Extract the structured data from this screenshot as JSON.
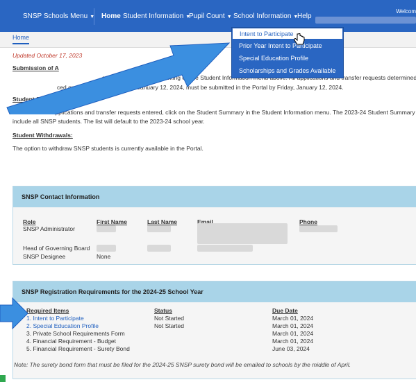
{
  "nav": {
    "menu_label": "SNSP Schools Menu",
    "home": "Home",
    "student_info": "Student Information",
    "pupil_count": "Pupil Count",
    "school_info": "School Information",
    "help": "Help",
    "welcome": "Welcom"
  },
  "tab": {
    "home": "Home"
  },
  "dropdown": {
    "items": [
      "Intent to Participate",
      "Prior Year Intent to Participate",
      "Special Education Profile",
      "Scholarships and Grades Available"
    ],
    "active_index": 0
  },
  "content": {
    "updated": "Updated October 17, 2023",
    "submission_heading": "Submission of A",
    "submission_heading_tail": "...:",
    "submission_line1": "s can be submitted by clicking on the Student Information menu above. All applications and transfer requests determined",
    "submission_line2": "ced on a waiting list by Friday, January 12, 2024, must be submitted in the Portal by Friday, January 12, 2024.",
    "summary_heading": "Student Summary:",
    "summary_line1": "To see a list of applications and transfer requests entered, click on the Student Summary in the Student Information menu. The 2023-24 Student Summary wi",
    "summary_line2": "include all SNSP students. The list will default to the 2023-24 school year.",
    "withdrawals_heading": "Student Withdrawals:",
    "withdrawals_line": "The option to withdraw SNSP students is currently available in the Portal."
  },
  "contact": {
    "title": "SNSP Contact Information",
    "headers": {
      "role": "Role",
      "first": "First Name",
      "last": "Last Name",
      "email": "Email",
      "phone": "Phone"
    },
    "rows": [
      {
        "role": "SNSP Administrator",
        "first": ""
      },
      {
        "role": "Head of Governing Board",
        "first": ""
      },
      {
        "role": "SNSP Designee",
        "first": "None"
      }
    ]
  },
  "registration": {
    "title": "SNSP Registration Requirements for the 2024-25 School Year",
    "headers": {
      "items": "Required Items",
      "status": "Status",
      "due": "Due Date"
    },
    "rows": [
      {
        "item": "1. Intent to Participate",
        "link": true,
        "status": "Not Started",
        "due": "March 01, 2024"
      },
      {
        "item": "2. Special Education Profile",
        "link": true,
        "status": "Not Started",
        "due": "March 01, 2024"
      },
      {
        "item": "3. Private School Requirements Form",
        "link": false,
        "status": "",
        "due": "March 01, 2024"
      },
      {
        "item": "4. Financial Requirement - Budget",
        "link": false,
        "status": "",
        "due": "March 01, 2024"
      },
      {
        "item": "5. Financial Requirement - Surety Bond",
        "link": false,
        "status": "",
        "due": "June 03, 2024"
      }
    ],
    "note": "Note: The surety bond form that must be filed for the 2024-25 SNSP surety bond will be emailed to schools by the middle of April."
  },
  "colors": {
    "nav": "#2a66c2",
    "panel_head": "#a9d4e8",
    "arrow": "#3b8fe0"
  }
}
